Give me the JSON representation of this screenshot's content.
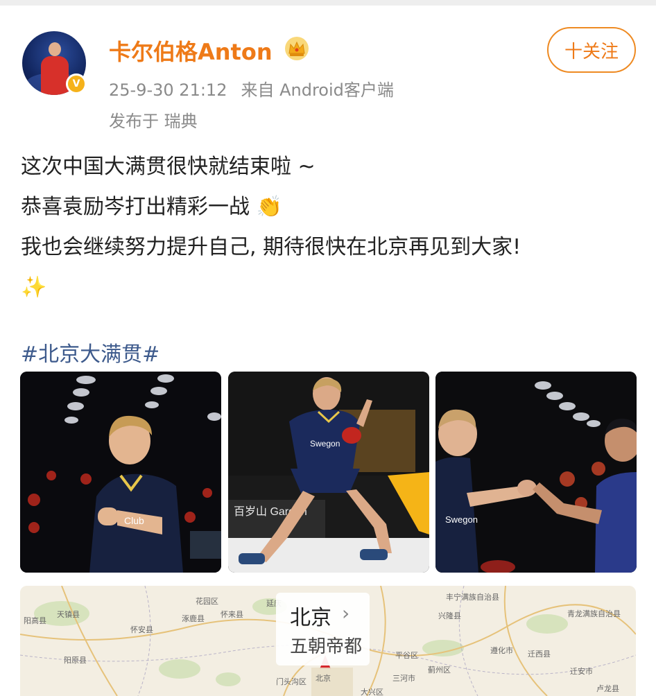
{
  "post": {
    "username": "卡尔伯格Anton",
    "timestamp": "25-9-30 21:12",
    "source": "来自 Android客户端",
    "location": "发布于 瑞典",
    "follow_button": "十关注",
    "verified_badge": "V",
    "text_lines": [
      "这次中国大满贯很快就结束啦 ~",
      "恭喜袁励岑打出精彩一战",
      "我也会继续努力提升自己, 期待很快在北京再见到大家!"
    ],
    "emojis": {
      "clap": "👏",
      "sparkles": "✨"
    },
    "hashtag": "#北京大满贯#"
  },
  "photos": [
    {
      "jersey_text": "Club"
    },
    {
      "jersey_text": "Swegon",
      "board_text": "百岁山 Garden"
    },
    {
      "jersey_text": "Swegon"
    }
  ],
  "map": {
    "title": "北京",
    "subtitle": "五朝帝都",
    "labels": [
      "阳高县",
      "天镇县",
      "阳原县",
      "怀安县",
      "花园区",
      "涿鹿县",
      "怀来县",
      "延庆",
      "丰宁满族自治县",
      "兴隆县",
      "迁西县",
      "平谷区",
      "蓟州区",
      "三河市",
      "遵化市",
      "门头沟区",
      "北京",
      "大兴区",
      "卢龙县",
      "迁安市",
      "青龙满族自治县"
    ]
  },
  "colors": {
    "username": "#ee7a18",
    "meta": "#8a8a8a",
    "hashtag": "#3d5a8c",
    "follow_border": "#ee8a22",
    "badge": "#f5b21b"
  }
}
